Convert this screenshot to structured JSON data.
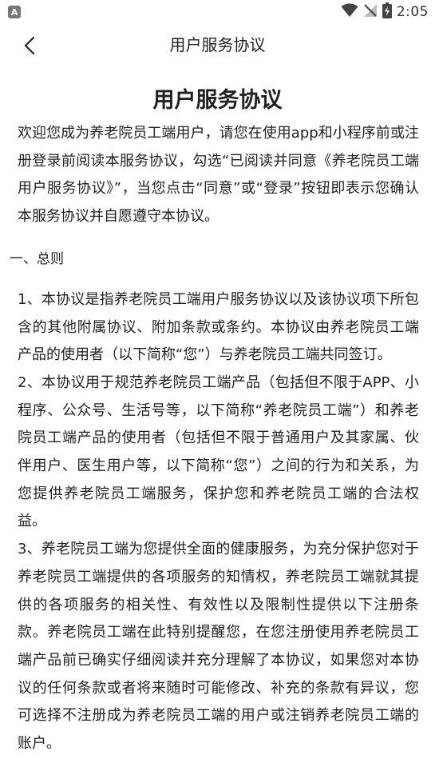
{
  "status_bar": {
    "app_icon_letter": "A",
    "time": "2:05"
  },
  "nav": {
    "title": "用户服务协议"
  },
  "document": {
    "title": "用户服务协议",
    "intro": "欢迎您成为养老院员工端用户，请您在使用app和小程序前或注册登录前阅读本服务协议，勾选“已阅读并同意《养老院员工端用户服务协议》”，当您点击“同意”或“登录”按钮即表示您确认本服务协议并自愿遵守本协议。",
    "section_1_heading": "一、总则",
    "clauses": [
      "1、本协议是指养老院员工端用户服务协议以及该协议项下所包含的其他附属协议、附加条款或条约。本协议由养老院员工端产品的使用者（以下简称“您”）与养老院员工端共同签订。",
      "2、本协议用于规范养老院员工端产品（包括但不限于APP、小程序、公众号、生活号等，以下简称“养老院员工端”）和养老院员工端产品的使用者（包括但不限于普通用户及其家属、伙伴用户、医生用户等，以下简称“您”）之间的行为和关系，为您提供养老院员工端服务，保护您和养老院员工端的合法权益。",
      "3、养老院员工端为您提供全面的健康服务，为充分保护您对于养老院员工端提供的各项服务的知情权，养老院员工端就其提供的各项服务的相关性、有效性以及限制性提供以下注册条款。养老院员工端在此特别提醒您，在您注册使用养老院员工端产品前已确实仔细阅读并充分理解了本协议，如果您对本协议的任何条款或者将来随时可能修改、补充的条款有异议，您可选择不注册成为养老院员工端的用户或注销养老院员工端的账户。"
    ]
  }
}
